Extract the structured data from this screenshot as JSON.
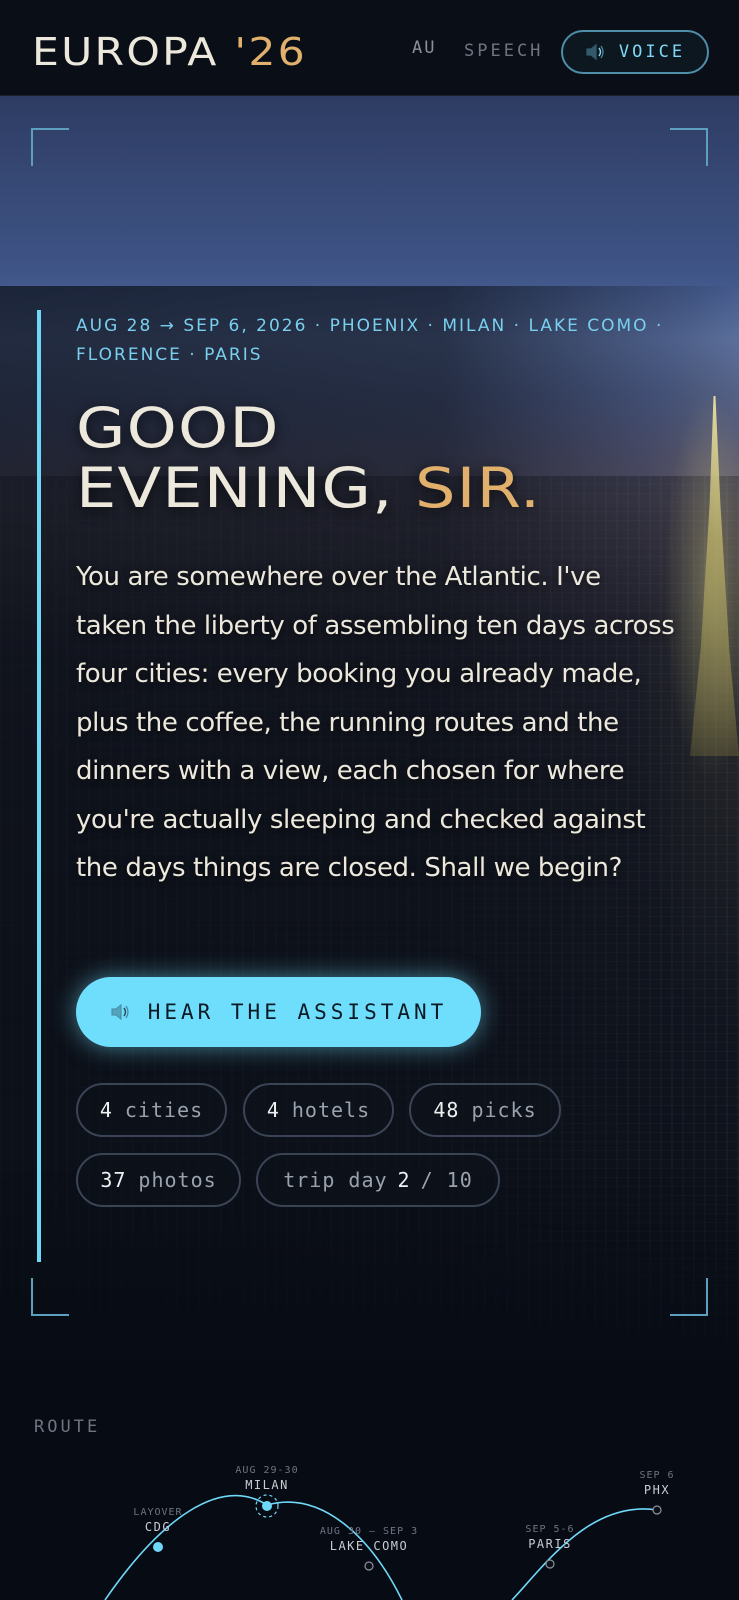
{
  "header": {
    "brand_name": "EUROPA",
    "brand_year": "'26",
    "nav_au": "AU",
    "nav_speech": "SPEECH",
    "voice_label": "VOICE",
    "voice_icon": "speaker-icon"
  },
  "hero": {
    "meta": "AUG 28 → SEP 6, 2026 · PHOENIX · MILAN · LAKE COMO · FLORENCE · PARIS",
    "greeting_line1": "GOOD",
    "greeting_line2": "EVENING,",
    "greeting_sir": "SIR.",
    "intro": "You are somewhere over the Atlantic. I've taken the liberty of assembling ten days across four cities: every booking you already made, plus the coffee, the running routes and the dinners with a view, each chosen for where you're actually sleeping and checked against the days things are closed. Shall we begin?",
    "cta_label": "HEAR THE ASSISTANT",
    "cta_icon": "speaker-icon"
  },
  "stats": {
    "cities": {
      "value": "4",
      "label": "cities"
    },
    "hotels": {
      "value": "4",
      "label": "hotels"
    },
    "picks": {
      "value": "48",
      "label": "picks"
    },
    "photos": {
      "value": "37",
      "label": "photos"
    },
    "trip_day": {
      "label": "trip day",
      "current": "2",
      "total": "/ 10"
    }
  },
  "route": {
    "title": "ROUTE",
    "stops": [
      {
        "date": "LAYOVER",
        "name": "CDG"
      },
      {
        "date": "AUG 29-30",
        "name": "MILAN",
        "current": true
      },
      {
        "date": "AUG 30 – SEP 3",
        "name": "LAKE COMO"
      },
      {
        "date": "SEP 5-6",
        "name": "PARIS"
      },
      {
        "date": "SEP 6",
        "name": "PHX"
      }
    ]
  },
  "colors": {
    "accent": "#6fddfc",
    "gold": "#e0b06c",
    "background": "#070b14",
    "text": "#ece8dc"
  }
}
